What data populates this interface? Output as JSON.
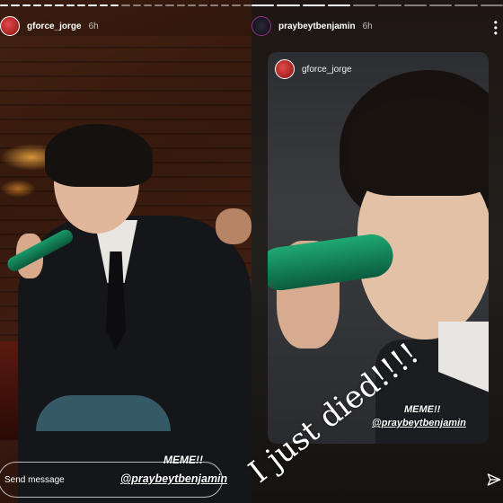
{
  "left_story": {
    "username": "gforce_jorge",
    "time": "6h",
    "meme_label": "MEME!!",
    "handle_sticker": "@praybeytbenjamin",
    "send_placeholder": "Send message"
  },
  "right_story": {
    "username": "praybeytbenjamin",
    "time": "6h",
    "embedded_post": {
      "username": "gforce_jorge",
      "meme_label": "MEME!!",
      "handle_sticker": "@praybeytbenjamin"
    },
    "caption": "I just died!!!!"
  },
  "icons": {
    "more": "more-options-icon",
    "send": "paper-plane-icon"
  },
  "colors": {
    "mic_green": "#1a9a6a",
    "text": "#ffffff"
  }
}
